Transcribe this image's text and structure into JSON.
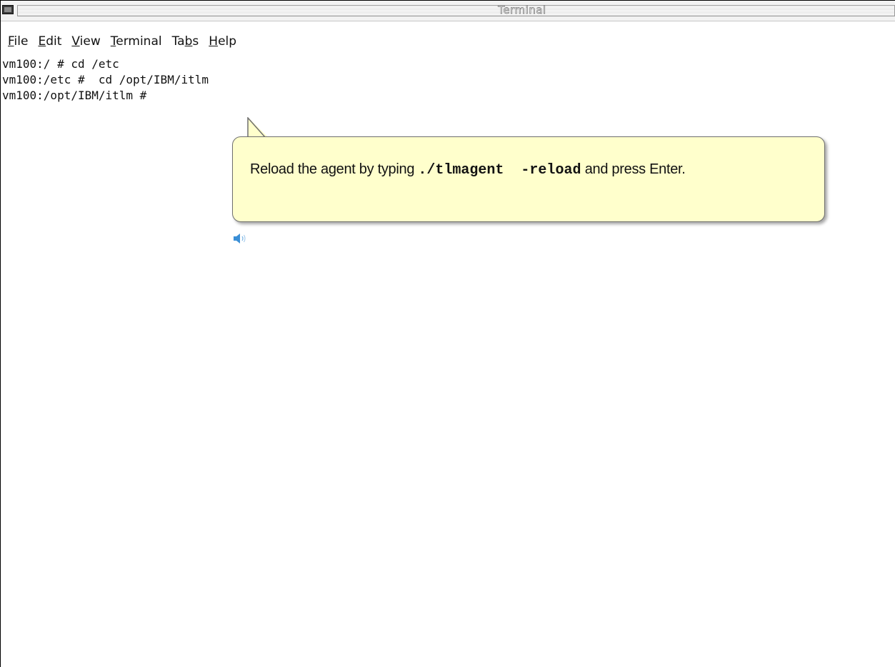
{
  "window": {
    "title": "Terminal"
  },
  "menu": {
    "items": [
      {
        "pre": "",
        "mn": "F",
        "post": "ile"
      },
      {
        "pre": "",
        "mn": "E",
        "post": "dit"
      },
      {
        "pre": "",
        "mn": "V",
        "post": "iew"
      },
      {
        "pre": "",
        "mn": "T",
        "post": "erminal"
      },
      {
        "pre": "Ta",
        "mn": "b",
        "post": "s"
      },
      {
        "pre": "",
        "mn": "H",
        "post": "elp"
      }
    ]
  },
  "terminal": {
    "lines": [
      "vm100:/ # cd /etc",
      "vm100:/etc #  cd /opt/IBM/itlm",
      "vm100:/opt/IBM/itlm #"
    ]
  },
  "callout": {
    "text_before": "Reload the agent by typing ",
    "command": "./tlmagent  -reload",
    "text_after": " and press Enter."
  },
  "icons": {
    "window_menu": "terminal-window-icon",
    "audio": "speaker-icon"
  },
  "colors": {
    "callout_bg": "#ffffcc",
    "callout_border": "#6f6f6f",
    "speaker": "#3a8fd6"
  }
}
